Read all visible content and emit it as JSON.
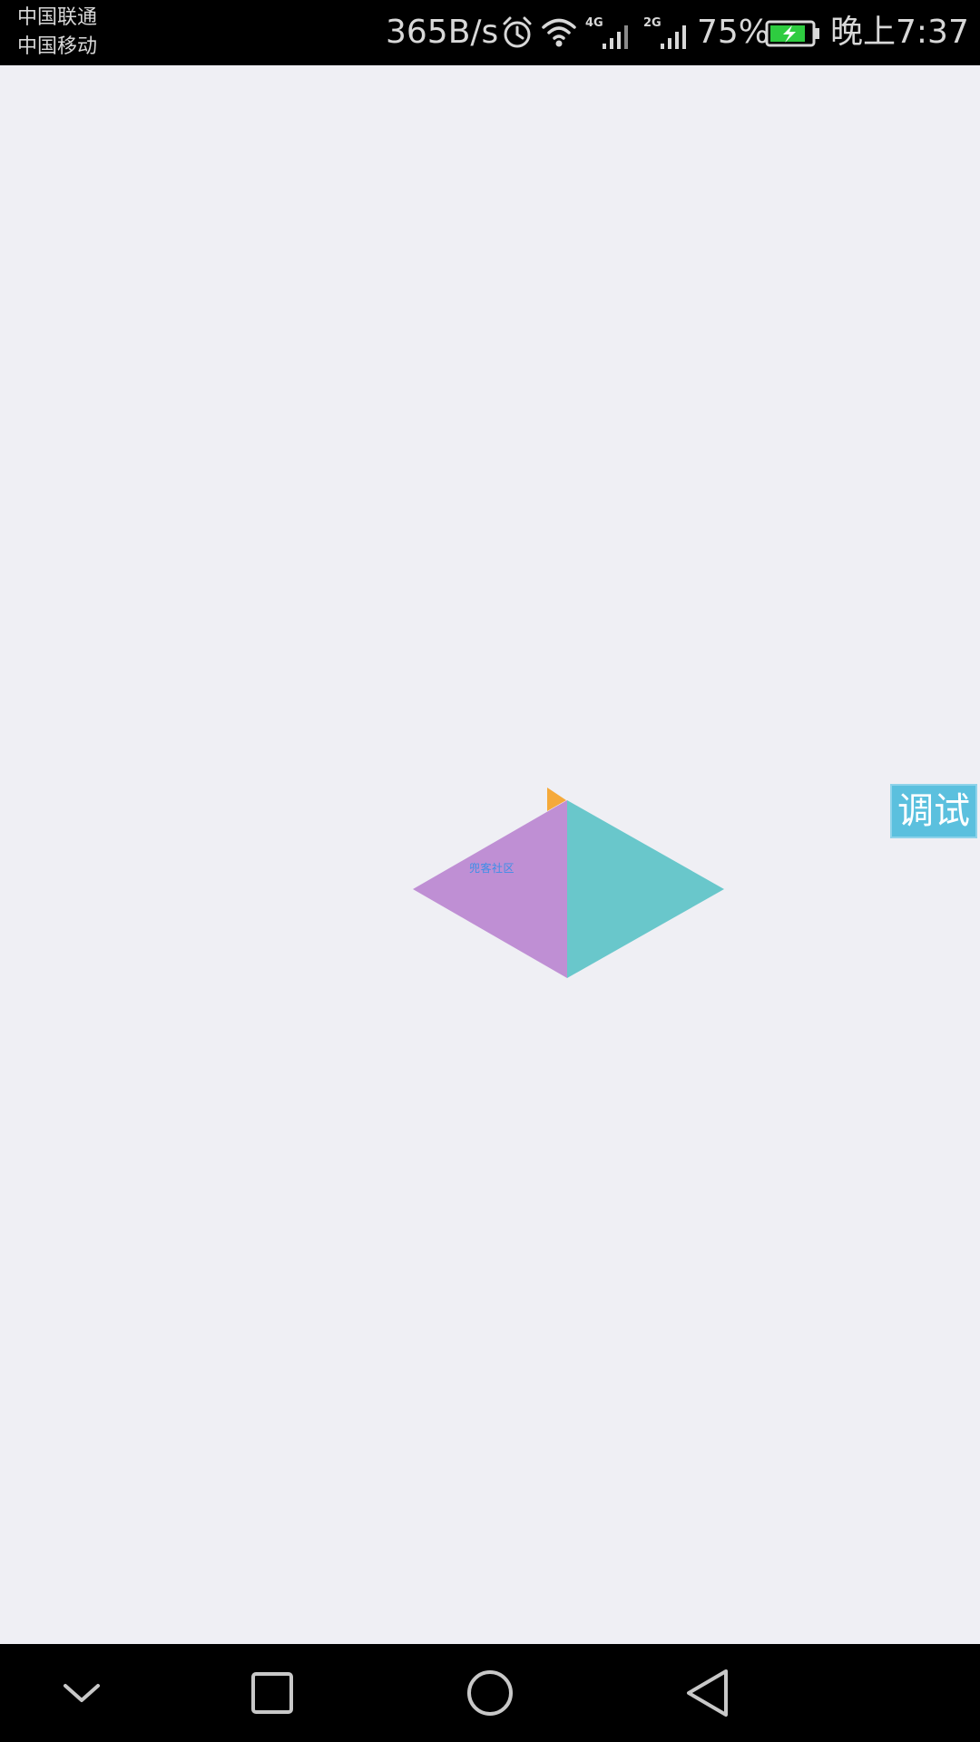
{
  "status_bar": {
    "carrier_1": "中国联通",
    "carrier_2": "中国移动",
    "net_speed": "365B/s",
    "network_1": "4G",
    "network_2": "2G",
    "battery_percent": "75%",
    "time": "晚上7:37",
    "icons": [
      "alarm-icon",
      "wifi-icon",
      "signal-4g-icon",
      "signal-2g-icon",
      "battery-charging-icon"
    ]
  },
  "main": {
    "diagram_caption": "兜客社区",
    "colors": {
      "left_triangle": "#bf8fd4",
      "right_triangle": "#69c7cb",
      "flag": "#f5a93a",
      "caption": "#3b8fe8"
    }
  },
  "debug_button": {
    "label": "调试",
    "color": "#5bc0de"
  },
  "nav_bar": {
    "icons": [
      "chevron-down-icon",
      "recent-apps-icon",
      "home-icon",
      "back-icon"
    ]
  }
}
